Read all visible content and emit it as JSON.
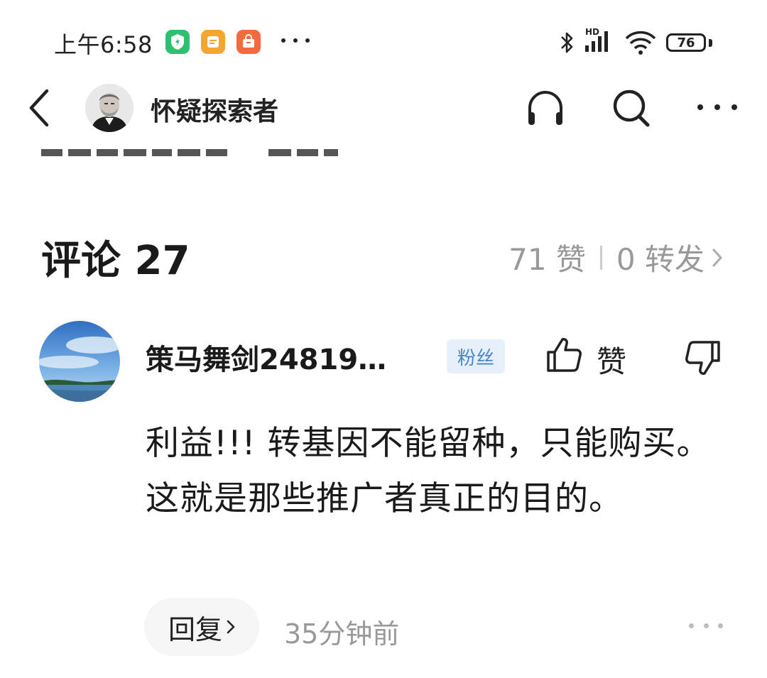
{
  "status_bar": {
    "time": "上午6:58",
    "battery": "76",
    "network_label": "HD",
    "icons": [
      "security-app-icon",
      "notes-app-icon",
      "shop-app-icon",
      "bluetooth-icon",
      "signal-icon",
      "wifi-icon",
      "battery-icon"
    ]
  },
  "nav": {
    "title": "怀疑探索者",
    "icons": [
      "back-icon",
      "headphones-icon",
      "search-icon",
      "more-icon"
    ]
  },
  "comments_header": {
    "title": "评论 27",
    "likes": "71 赞",
    "shares": "0 转发"
  },
  "comment": {
    "username": "策马舞剑24819…",
    "badge": "粉丝",
    "like_label": "赞",
    "text": "利益!!! 转基因不能留种，只能购买。这就是那些推广者真正的目的。",
    "reply_label": "回复",
    "time": "35分钟前"
  },
  "colors": {
    "badge_bg": "#e6f0fb",
    "badge_text": "#4a86c8",
    "muted_text": "#999999"
  }
}
